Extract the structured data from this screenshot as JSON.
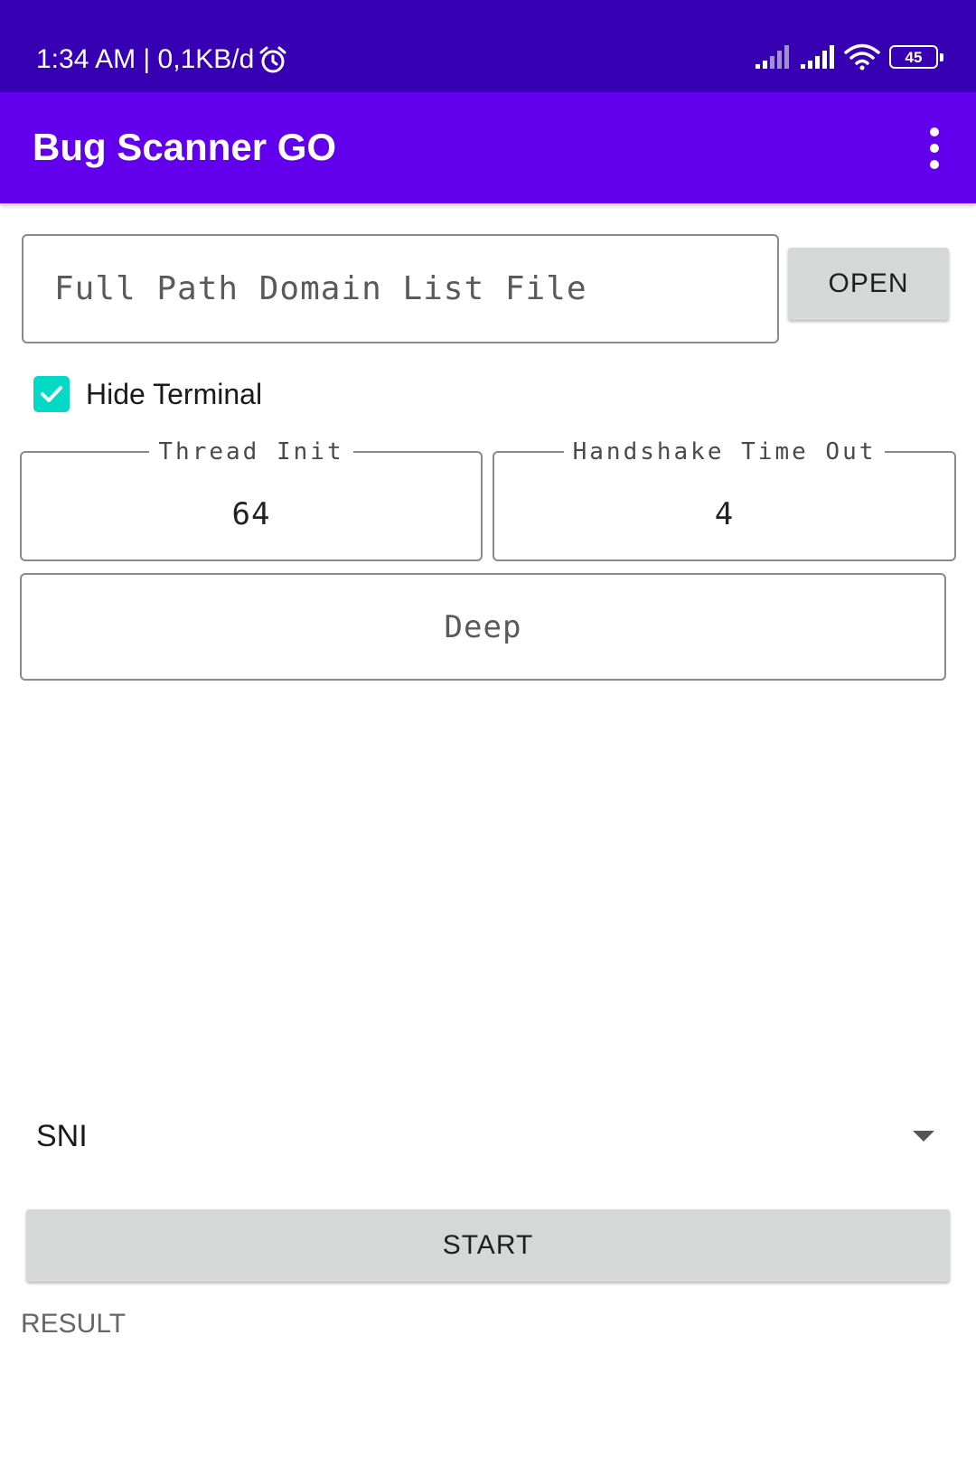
{
  "status_bar": {
    "time": "1:34 AM",
    "separator": " | ",
    "data_rate": "0,1KB/d",
    "battery_level": "45",
    "icons": [
      "alarm-icon",
      "signal-icon-sim1",
      "signal-icon-sim2",
      "wifi-icon",
      "battery-icon"
    ]
  },
  "app_bar": {
    "title": "Bug Scanner GO",
    "menu_icon": "overflow-menu-icon"
  },
  "domain_file": {
    "placeholder": "Full Path Domain List File",
    "value": "",
    "open_label": "OPEN"
  },
  "hide_terminal": {
    "label": "Hide Terminal",
    "checked": true
  },
  "thread_init": {
    "label": "Thread Init",
    "value": "64"
  },
  "handshake_timeout": {
    "label": "Handshake Time Out",
    "value": "4"
  },
  "deep": {
    "placeholder": "Deep"
  },
  "mode_select": {
    "value": "SNI"
  },
  "start_label": "START",
  "result_label": "RESULT",
  "colors": {
    "status_bar": "#3700b3",
    "app_bar": "#6200ee",
    "checkbox": "#03dac5",
    "button_bg": "#d6d7d7"
  }
}
